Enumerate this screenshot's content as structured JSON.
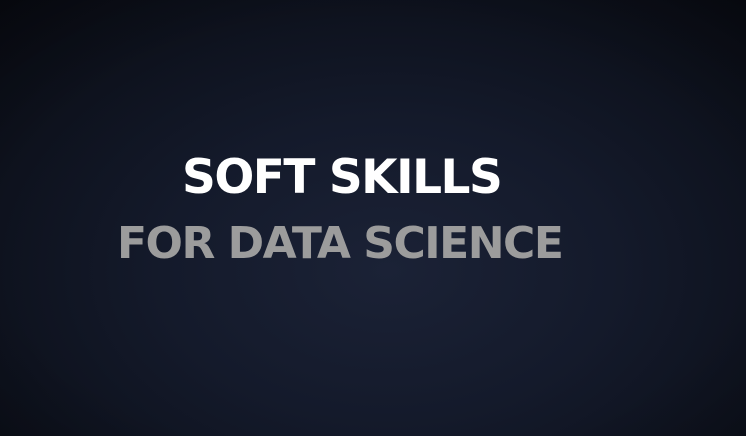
{
  "title": {
    "line1": "SOFT SKILLS",
    "line2": "FOR DATA SCIENCE"
  },
  "colors": {
    "background": "#121829",
    "line1": "#ffffff",
    "line2": "#9c9c9c"
  }
}
